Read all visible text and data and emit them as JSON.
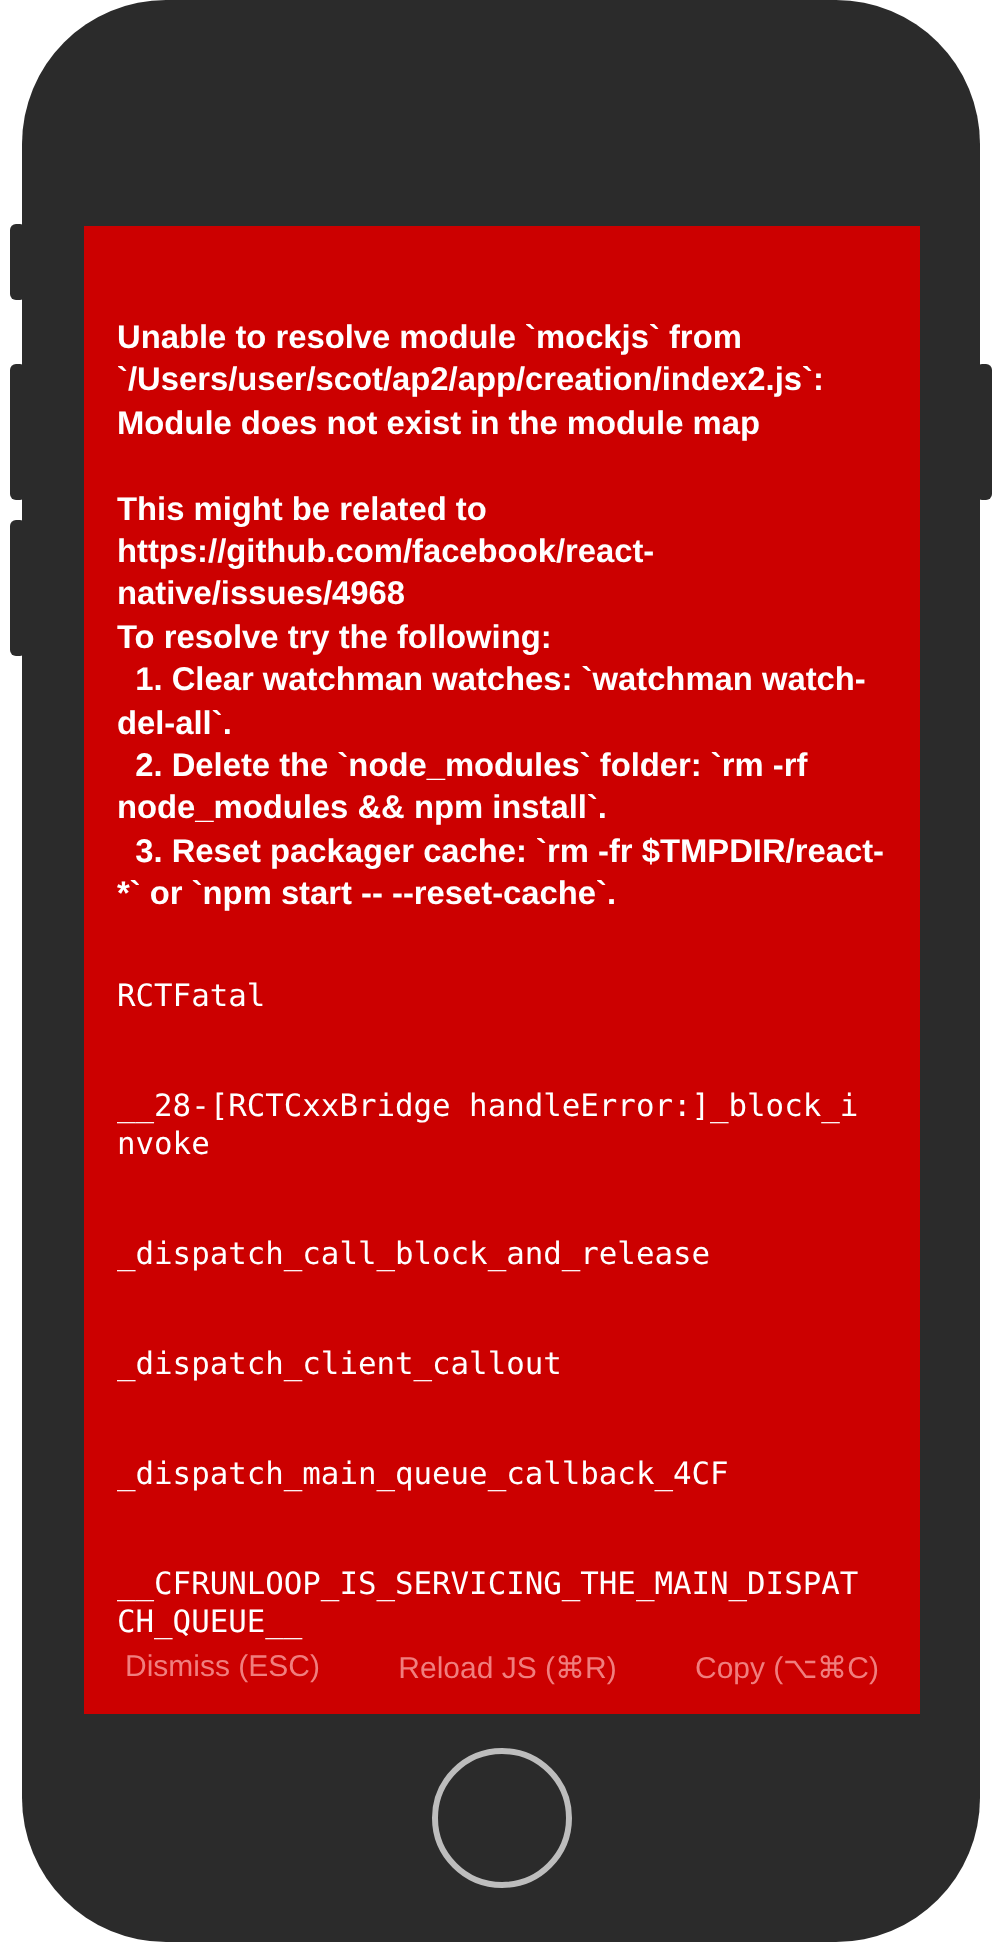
{
  "error_screen": {
    "message": "Unable to resolve module `mockjs` from `/Users/user/scot/ap2/app/creation/index2.js`: Module does not exist in the module map\n\nThis might be related to https://github.com/facebook/react-native/issues/4968\nTo resolve try the following:\n  1. Clear watchman watches: `watchman watch-del-all`.\n  2. Delete the `node_modules` folder: `rm -rf node_modules && npm install`.\n  3. Reset packager cache: `rm -fr $TMPDIR/react-*` or `npm start -- --reset-cache`.",
    "stack_frames": [
      "RCTFatal",
      "__28-[RCTCxxBridge handleError:]_block_invoke",
      "_dispatch_call_block_and_release",
      "_dispatch_client_callout",
      "_dispatch_main_queue_callback_4CF",
      "__CFRUNLOOP_IS_SERVICING_THE_MAIN_DISPATCH_QUEUE__"
    ],
    "buttons": [
      "Dismiss (ESC)",
      "Reload JS (⌘R)",
      "Copy (⌥⌘C)"
    ]
  }
}
